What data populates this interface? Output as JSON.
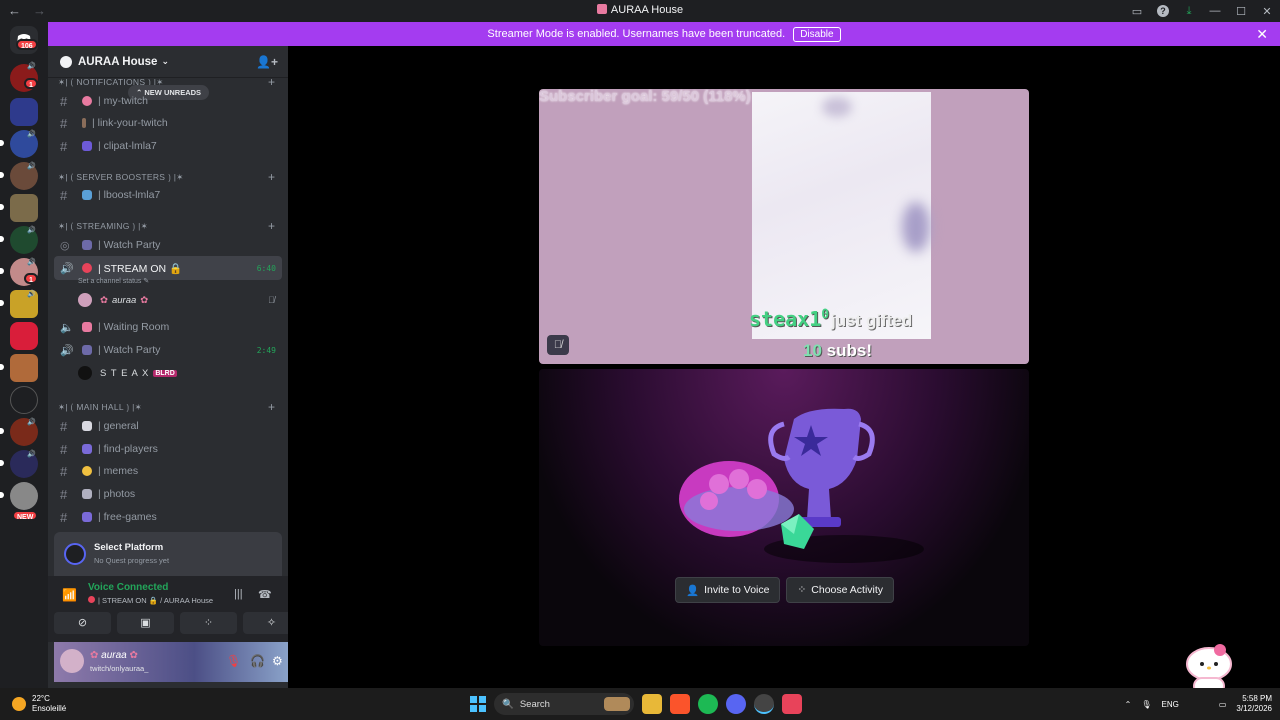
{
  "window": {
    "title": "AURAA House"
  },
  "banner": {
    "text": "Streamer Mode is enabled. Usernames have been truncated.",
    "button": "Disable"
  },
  "guilds": {
    "home_badge": "106",
    "badge1": "1",
    "badge2": "1",
    "new_label": "NEW"
  },
  "server": {
    "name": "AURAA House"
  },
  "new_unreads": "NEW UNREADS",
  "categories": {
    "notifications": "✶| ⟮ NOTIFICATIONS ⟯ |✶",
    "boosters": "✶| ⟮ SERVER BOOSTERS ⟯ |✶",
    "streaming": "✶| ⟮ STREAMING ⟯ |✶",
    "mainhall": "✶| ⟮ MAIN HALL ⟯ |✶"
  },
  "channels": {
    "my_twitch": "| my-twitch",
    "link_twitch": "| link-your-twitch",
    "clipat": "| clipat-lmla7",
    "boost": "| lboost-lmla7",
    "watch_party1": "| Watch Party",
    "stream_on": "| STREAM ON 🔒",
    "stream_on_time": "6:40",
    "stream_on_status": "Set a channel status",
    "waiting_room": "| Waiting Room",
    "watch_party2": "| Watch Party",
    "watch_party2_time": "2:49",
    "general": "| general",
    "find_players": "| find-players",
    "memes": "| memes",
    "photos": "| photos",
    "free_games": "| free-games"
  },
  "voice_users": {
    "auraa": "auraa",
    "steax": "S T E A X",
    "steax_tag": "BLRD"
  },
  "quest": {
    "title": "Select Platform",
    "subtitle": "No Quest progress yet"
  },
  "voice_panel": {
    "status": "Voice Connected",
    "location": "| STREAM ON 🔒 / AURAA House"
  },
  "user": {
    "name": "auraa",
    "sub": "twitch/onlyauraa_"
  },
  "stream": {
    "goal": "Subscriber goal: 59/50 (118%)",
    "gift_user": "steax1",
    "gift_sup": "0",
    "gift_text": "just gifted",
    "gift_count": "10",
    "gift_unit": "subs!"
  },
  "activity": {
    "invite": "Invite to Voice",
    "choose": "Choose Activity"
  },
  "taskbar": {
    "temp": "22°C",
    "weather": "Ensoleillé",
    "search": "Search",
    "lang": "ENG",
    "time": "5:58 PM",
    "date": "3/12/2026"
  },
  "colors": {
    "accent": "#a43cf0",
    "voice_green": "#23a55a",
    "discord_blurple": "#5865f2"
  }
}
